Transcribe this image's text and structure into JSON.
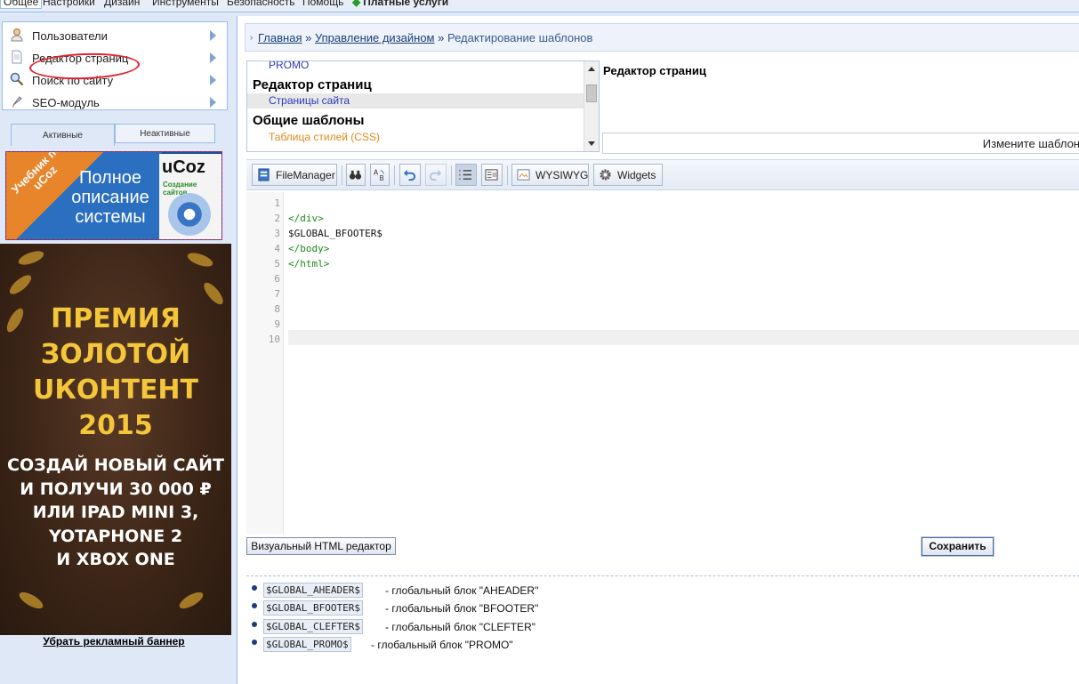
{
  "topmenu": {
    "items": [
      "Общее",
      "Настройки",
      "Дизайн",
      "Инструменты",
      "Безопасность",
      "Помощь"
    ],
    "paid": "Платные услуги"
  },
  "sidebar": {
    "items": [
      {
        "label": "Пользователи"
      },
      {
        "label": "Редактор страниц"
      },
      {
        "label": "Поиск по сайту"
      },
      {
        "label": "SEO-модуль"
      }
    ],
    "tabs": {
      "active": "Активные",
      "inactive": "Неактивные"
    },
    "banner_small": {
      "ribbon": "Учебник по uCoz",
      "text": "Полное описание системы",
      "brand": "uCoz",
      "subtitle": "Создание сайтов"
    },
    "banner_big": {
      "title": [
        "ПРЕМИЯ",
        "ЗОЛОТОЙ",
        "UКОНТЕНТ",
        "2015"
      ],
      "promo": [
        "СОЗДАЙ НОВЫЙ САЙТ",
        "И ПОЛУЧИ 30 000 ₽",
        "ИЛИ IPAD MINI 3,",
        "YOTAPHONE 2",
        "И XBOX ONE"
      ]
    },
    "remove_banner": "Убрать рекламный баннер"
  },
  "breadcrumb": {
    "home": "Главная",
    "sep": "»",
    "design": "Управление дизайном",
    "current": "Редактирование шаблонов"
  },
  "templates": {
    "rows": [
      {
        "type": "item",
        "label": "PROMO",
        "color": "#2a3ab8"
      },
      {
        "type": "group",
        "label": "Редактор страниц"
      },
      {
        "type": "item",
        "label": "Страницы сайта",
        "color": "#2a3ab8"
      },
      {
        "type": "group",
        "label": "Общие шаблоны"
      },
      {
        "type": "item",
        "label": "Таблица стилей (CSS)",
        "color": "#e08a1a"
      }
    ]
  },
  "editor": {
    "title": "Редактор страниц",
    "change_text": "Измените шаблон"
  },
  "toolbar": {
    "filemanager": "FileManager",
    "wysiwyg": "WYSIWYG",
    "widgets": "Widgets"
  },
  "code": {
    "lines": [
      "",
      "</div>",
      "$GLOBAL_BFOOTER$",
      "</body>",
      "</html>",
      "",
      "",
      "",
      "",
      ""
    ],
    "active_line": 10
  },
  "buttons": {
    "visual": "Визуальный HTML редактор",
    "save": "Сохранить"
  },
  "globals": [
    {
      "tag": "$GLOBAL_AHEADER$",
      "desc": "- глобальный блок \"AHEADER\""
    },
    {
      "tag": "$GLOBAL_BFOOTER$",
      "desc": "- глобальный блок \"BFOOTER\""
    },
    {
      "tag": "$GLOBAL_CLEFTER$",
      "desc": "- глобальный блок \"CLEFTER\""
    },
    {
      "tag": "$GLOBAL_PROMO$",
      "desc": "- глобальный блок \"PROMO\""
    }
  ],
  "colors": {
    "accent": "#99bbe8",
    "link": "#1a3e7a",
    "banner_gold": "#f5c53a",
    "annotation_red": "#e0202a"
  }
}
